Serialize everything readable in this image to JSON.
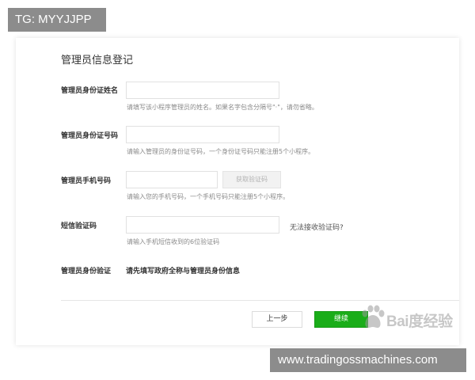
{
  "overlay": {
    "tag_text": "TG: MYYJJPP",
    "footer_url": "www.tradingossmachines.com"
  },
  "form": {
    "title": "管理员信息登记",
    "fields": [
      {
        "label": "管理员身份证姓名",
        "value": "",
        "hint": "请填写该小程序管理员的姓名。如果名字包含分隔号\"·\"，请勿省略。"
      },
      {
        "label": "管理员身份证号码",
        "value": "",
        "hint": "请输入管理员的身份证号码，一个身份证号码只能注册5个小程序。"
      },
      {
        "label": "管理员手机号码",
        "value": "",
        "hint": "请输入您的手机号码，一个手机号码只能注册5个小程序。"
      },
      {
        "label": "短信验证码",
        "value": "",
        "hint": "请输入手机短信收到的6位验证码"
      },
      {
        "label": "管理员身份验证",
        "value": "请先填写政府全称与管理员身份信息"
      }
    ],
    "get_code_button": "获取验证码",
    "no_code_link": "无法接收验证码?",
    "prev_button": "上一步",
    "next_button": "继续"
  },
  "watermark": {
    "brand": "Bai度经验"
  },
  "colors": {
    "primary_green": "#1aad19",
    "overlay_gray": "#8c8c8c"
  }
}
